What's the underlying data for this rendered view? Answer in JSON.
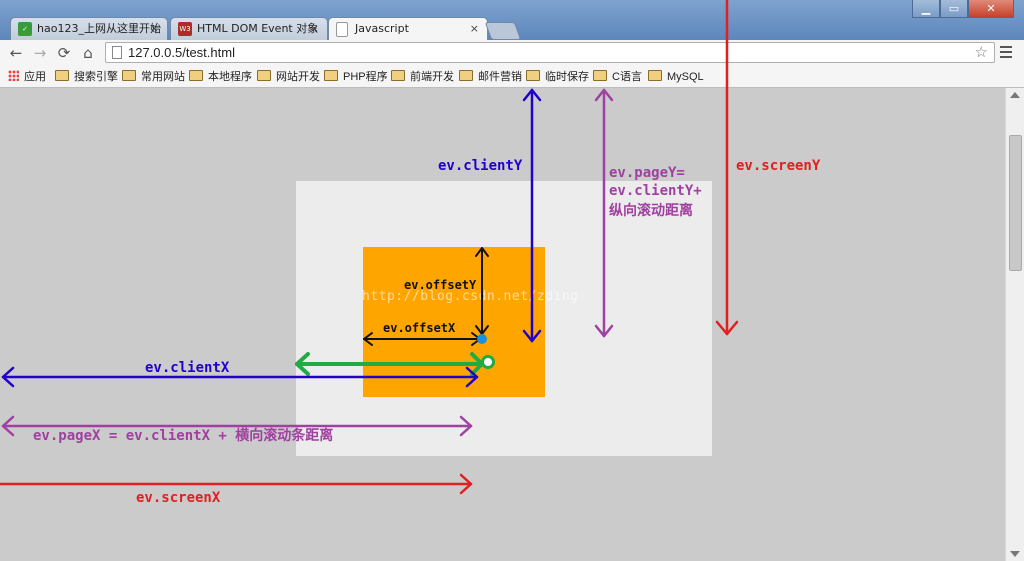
{
  "browser": {
    "tabs": [
      {
        "label": "hao123_上网从这里开始",
        "favicon": "hao123-icon",
        "active": false
      },
      {
        "label": "HTML DOM Event 对象",
        "favicon": "w3-icon",
        "favicon_text": "W3",
        "active": false
      },
      {
        "label": "Javascript",
        "favicon": "page-icon",
        "active": true
      }
    ],
    "tab_close": "×",
    "window_controls": {
      "minimize": "▁",
      "maximize": "▭",
      "close": "✕"
    },
    "url": "127.0.0.5/test.html",
    "bookmarks": [
      "应用",
      "搜索引擎",
      "常用网站",
      "本地程序",
      "网站开发",
      "PHP程序",
      "前端开发",
      "邮件营销",
      "临时保存",
      "C语言",
      "MySQL"
    ]
  },
  "diagram": {
    "labels": {
      "client_y": "ev.clientY",
      "page_y_line1": "ev.pageY=",
      "page_y_line2": "ev.clientY+",
      "page_y_line3": "纵向滚动距离",
      "screen_y": "ev.screenY",
      "offset_y": "ev.offsetY",
      "offset_x": "ev.offsetX",
      "client_x": "ev.clientX",
      "page_x": "ev.pageX = ev.clientX + 横向滚动条距离",
      "screen_x": "ev.screenX"
    },
    "watermark": "http://blog.csdn.net/zding",
    "colors": {
      "client": "#2200cc",
      "page": "#a040a0",
      "screen": "#e02020",
      "offset": "#111111",
      "green": "#22aa44",
      "point": "#1a90e0",
      "outer_box": "#ececec",
      "inner_box": "#ffa500",
      "page_bg": "#cbcbcb"
    }
  }
}
